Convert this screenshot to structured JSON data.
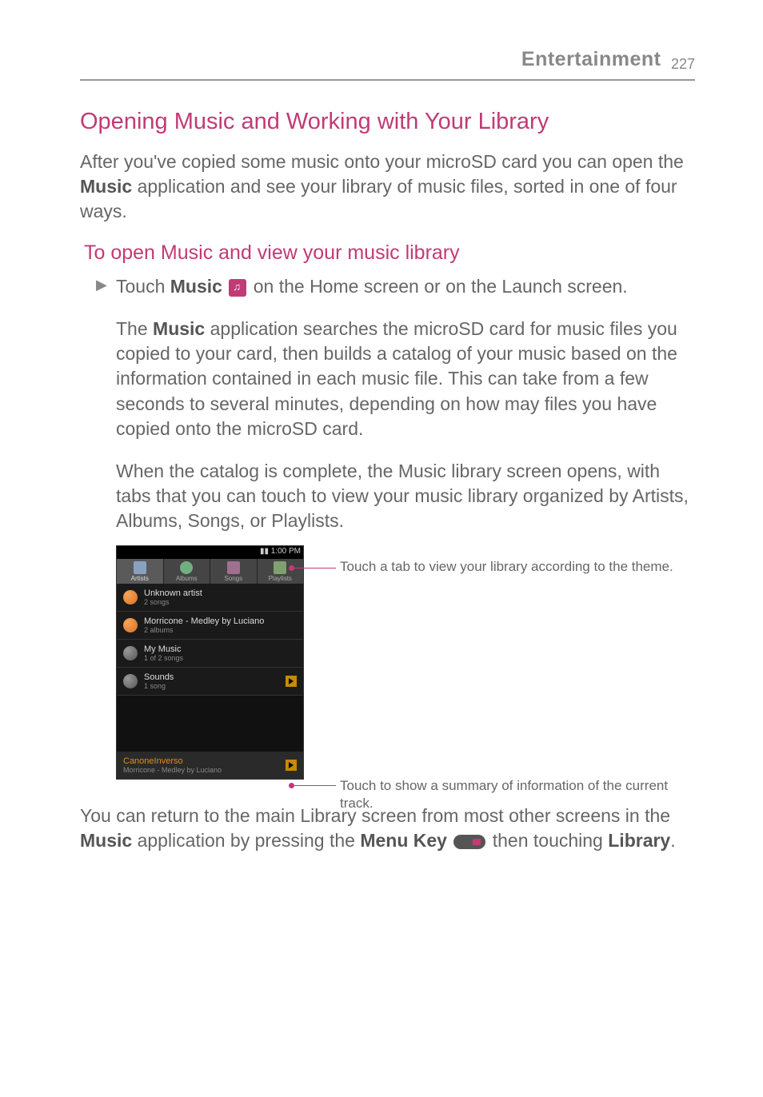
{
  "header": {
    "section": "Entertainment",
    "page": "227"
  },
  "h1": "Opening Music and Working with Your Library",
  "intro_before": "After you've copied some music onto your microSD card you can open the ",
  "intro_app": "Music",
  "intro_after": " application and see your library of music files, sorted in one of four ways.",
  "h2": "To open Music and view your music library",
  "bullet": {
    "touch": "Touch ",
    "music": "Music",
    "after_icon": " on the Home screen or on the Launch screen."
  },
  "para2_before": "The ",
  "para2_app": "Music",
  "para2_after": " application searches the microSD card for music files you copied to your card, then builds a catalog of your music based on the information contained in each music file. This can take from a few seconds to several minutes, depending on how may files you have copied onto the microSD card.",
  "para3": "When the catalog is complete, the Music library screen opens, with tabs that you can touch to view your music library organized by Artists, Albums, Songs, or Playlists.",
  "phone": {
    "time": "1:00 PM",
    "tabs": {
      "artists": "Artists",
      "albums": "Albums",
      "songs": "Songs",
      "playlists": "Playlists"
    },
    "rows": [
      {
        "title": "Unknown artist",
        "sub": "2 songs"
      },
      {
        "title": "Morricone - Medley by Luciano",
        "sub": "2 albums"
      },
      {
        "title": "My Music",
        "sub": "1 of 2 songs"
      },
      {
        "title": "Sounds",
        "sub": "1 song"
      }
    ],
    "nowplaying": {
      "title": "CanoneInverso",
      "sub": "Morricone - Medley by Luciano"
    }
  },
  "callout1": "Touch a tab to view your library according to the theme.",
  "callout2": "Touch to show a summary of information of the current track.",
  "closing_before": "You can return to the main Library screen from most other screens in the ",
  "closing_app": "Music",
  "closing_mid": " application by pressing the ",
  "closing_key": "Menu Key",
  "closing_after1": " then touching ",
  "closing_lib": "Library",
  "closing_period": "."
}
